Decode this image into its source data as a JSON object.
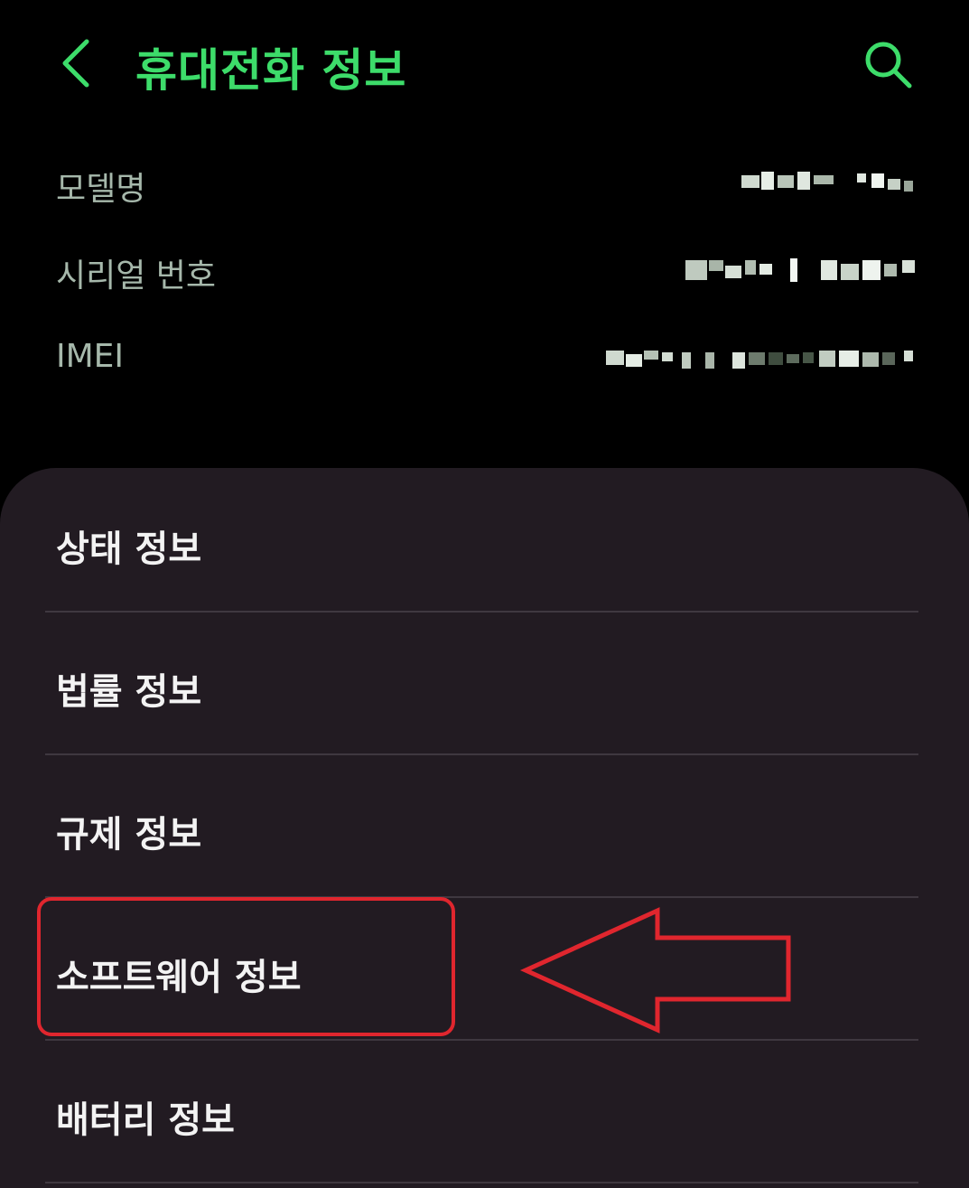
{
  "header": {
    "title": "휴대전화 정보",
    "back_icon": "back-chevron-icon",
    "search_icon": "search-icon",
    "accent_color": "#3ddc6a"
  },
  "device_info": [
    {
      "label": "모델명"
    },
    {
      "label": "시리얼 번호"
    },
    {
      "label": "IMEI"
    }
  ],
  "menu": {
    "items": [
      {
        "label": "상태 정보"
      },
      {
        "label": "법률 정보"
      },
      {
        "label": "규제 정보"
      },
      {
        "label": "소프트웨어 정보"
      },
      {
        "label": "배터리 정보"
      }
    ],
    "highlighted_item": "소프트웨어 정보",
    "annotation_color": "#e0262e"
  }
}
